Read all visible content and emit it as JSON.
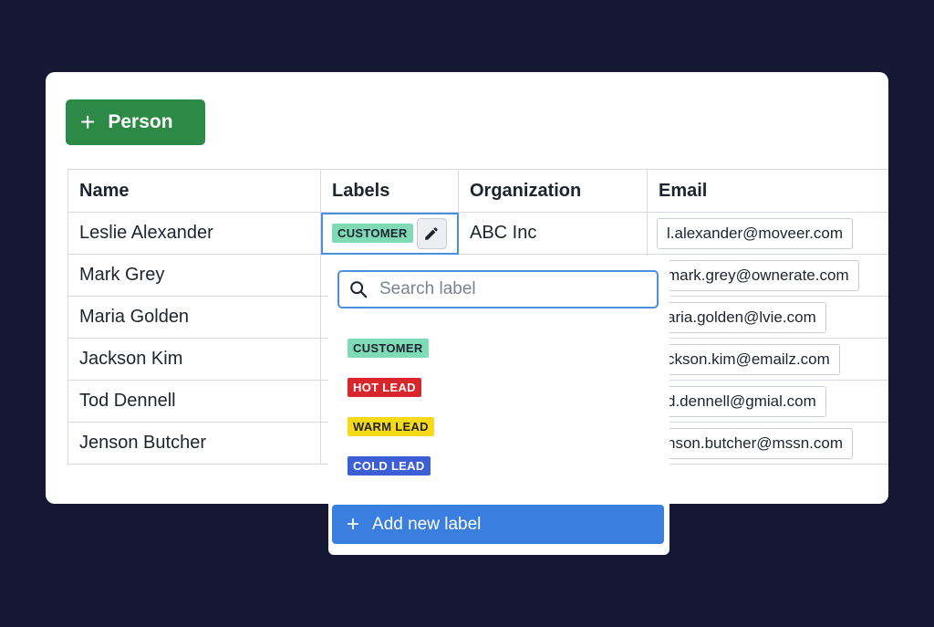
{
  "toolbar": {
    "add_person_label": "Person"
  },
  "table": {
    "headers": [
      "Name",
      "Labels",
      "Organization",
      "Email"
    ],
    "rows": [
      {
        "name": "Leslie Alexander",
        "label": "CUSTOMER",
        "organization": "ABC Inc",
        "email": "l.alexander@moveer.com"
      },
      {
        "name": "Mark Grey",
        "email": "mark.grey@ownerate.com"
      },
      {
        "name": "Maria Golden",
        "email": "aria.golden@lvie.com"
      },
      {
        "name": "Jackson Kim",
        "email": "ckson.kim@emailz.com"
      },
      {
        "name": "Tod Dennell",
        "email": "d.dennell@gmial.com"
      },
      {
        "name": "Jenson Butcher",
        "email": "nson.butcher@mssn.com"
      }
    ]
  },
  "dropdown": {
    "search_placeholder": "Search label",
    "options": [
      {
        "label": "CUSTOMER",
        "bg": "#7fdbb6",
        "fg": "#1f2330"
      },
      {
        "label": "HOT LEAD",
        "bg": "#d9262c",
        "fg": "#ffffff"
      },
      {
        "label": "WARM LEAD",
        "bg": "#f7d917",
        "fg": "#1f2330"
      },
      {
        "label": "COLD LEAD",
        "bg": "#3c5fd6",
        "fg": "#ffffff"
      }
    ],
    "add_new_label": "Add new label"
  },
  "colors": {
    "background": "#151833",
    "primary_green": "#2d8a46",
    "accent_blue": "#3a7ee0",
    "customer_chip": "#7fdbb6"
  },
  "icons": [
    "plus-icon",
    "pencil-icon",
    "search-icon"
  ]
}
